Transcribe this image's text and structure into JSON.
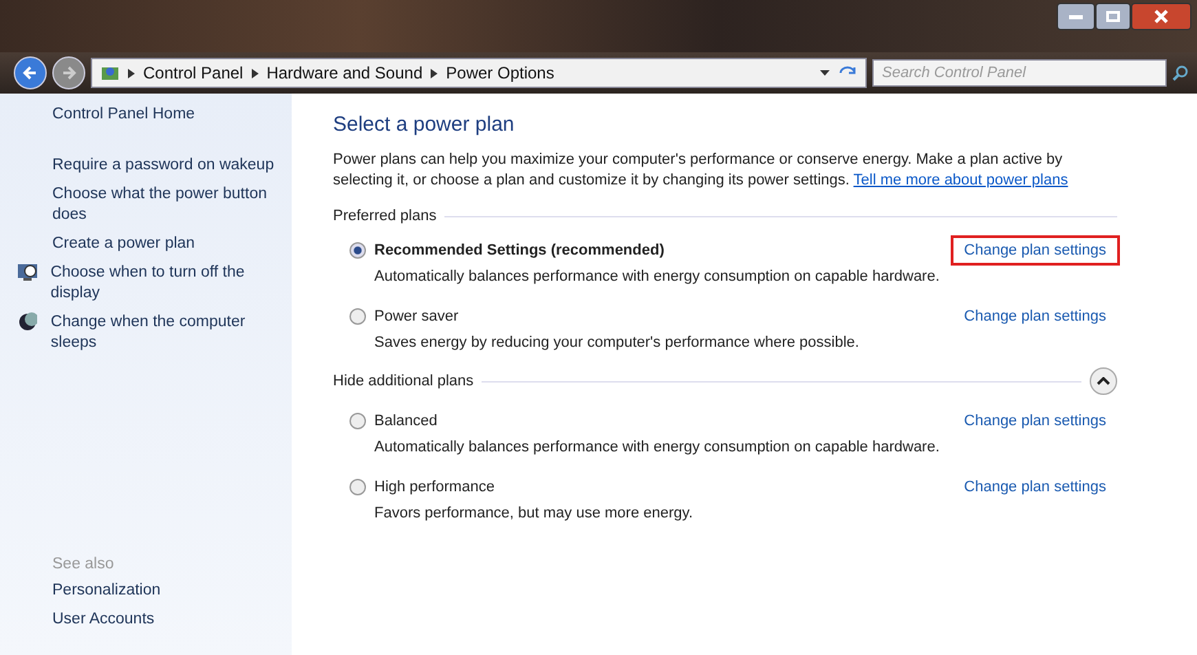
{
  "address_bar": {
    "crumbs": [
      "Control Panel",
      "Hardware and Sound",
      "Power Options"
    ],
    "search": {
      "placeholder": "Search Control Panel"
    }
  },
  "sidebar": {
    "home": "Control Panel Home",
    "items": [
      {
        "label": "Require a password on wakeup",
        "kind": "plain"
      },
      {
        "label": "Choose what the power button does",
        "kind": "plain"
      },
      {
        "label": "Create a power plan",
        "kind": "plain"
      },
      {
        "label": "Choose when to turn off the display",
        "kind": "display"
      },
      {
        "label": "Change when the computer sleeps",
        "kind": "sleep"
      }
    ],
    "see_also": {
      "heading": "See also",
      "links": [
        "Personalization",
        "User Accounts"
      ]
    }
  },
  "main": {
    "title": "Select a power plan",
    "intro": "Power plans can help you maximize your computer's performance or conserve energy. Make a plan active by selecting it, or choose a plan and customize it by changing its power settings.",
    "intro_link": "Tell me more about power plans",
    "groups": [
      {
        "heading": "Preferred plans",
        "plans": [
          {
            "name": "Recommended Settings (recommended)",
            "description": "Automatically balances performance with energy consumption on capable hardware.",
            "selected": true,
            "link": "Change plan settings",
            "highlighted": true
          },
          {
            "name": "Power saver",
            "description": "Saves energy by reducing your computer's performance where possible.",
            "selected": false,
            "link": "Change plan settings",
            "highlighted": false
          }
        ]
      },
      {
        "heading": "Hide additional plans",
        "expanded": true,
        "plans": [
          {
            "name": "Balanced",
            "description": "Automatically balances performance with energy consumption on capable hardware.",
            "selected": false,
            "link": "Change plan settings",
            "highlighted": false
          },
          {
            "name": "High performance",
            "description": "Favors performance, but may use more energy.",
            "selected": false,
            "link": "Change plan settings",
            "highlighted": false
          }
        ]
      }
    ]
  }
}
